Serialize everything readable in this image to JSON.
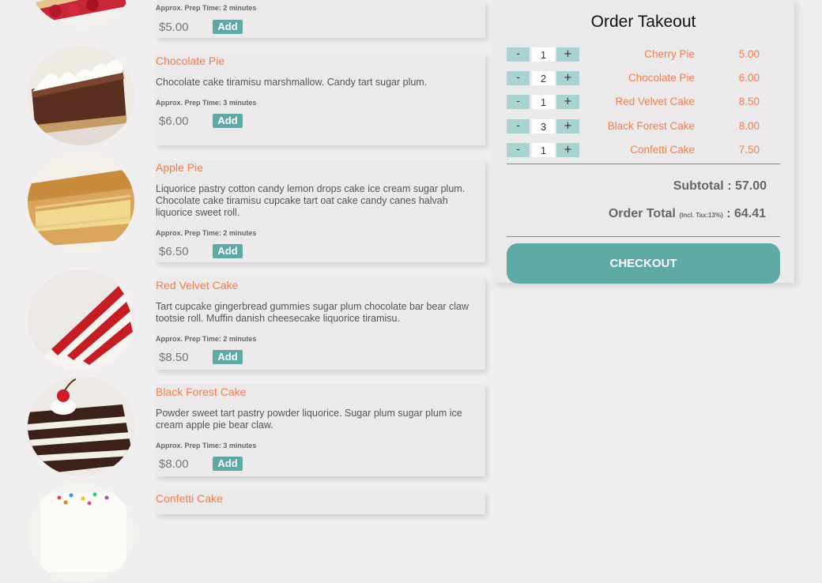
{
  "menu": {
    "items": [
      {
        "title": "",
        "description": "",
        "prep": "Approx. Prep Time: 2 minutes",
        "price": "$5.00",
        "add_label": "Add"
      },
      {
        "title": "Chocolate Pie",
        "description": "Chocolate cake tiramisu marshmallow. Candy tart sugar plum.",
        "prep": "Approx. Prep Time: 3 minutes",
        "price": "$6.00",
        "add_label": "Add"
      },
      {
        "title": "Apple Pie",
        "description": "Liquorice pastry cotton candy lemon drops cake ice cream sugar plum. Chocolate cake tiramisu cupcake tart oat cake candy canes halvah liquorice sweet roll.",
        "prep": "Approx. Prep Time: 2 minutes",
        "price": "$6.50",
        "add_label": "Add"
      },
      {
        "title": "Red Velvet Cake",
        "description": "Tart cupcake gingerbread gummies sugar plum chocolate bar bear claw tootsie roll. Muffin danish cheesecake liquorice tiramisu.",
        "prep": "Approx. Prep Time: 2 minutes",
        "price": "$8.50",
        "add_label": "Add"
      },
      {
        "title": "Black Forest Cake",
        "description": "Powder sweet tart pastry powder liquorice. Sugar plum sugar plum ice cream apple pie bear claw.",
        "prep": "Approx. Prep Time: 3 minutes",
        "price": "$8.00",
        "add_label": "Add"
      },
      {
        "title": "Confetti Cake"
      }
    ]
  },
  "order": {
    "title": "Order Takeout",
    "minus_label": "-",
    "plus_label": "+",
    "items": [
      {
        "name": "Cherry Pie",
        "qty": "1",
        "amount": "5.00"
      },
      {
        "name": "Chocolate Pie",
        "qty": "2",
        "amount": "6.00"
      },
      {
        "name": "Red Velvet Cake",
        "qty": "1",
        "amount": "8.50"
      },
      {
        "name": "Black Forest Cake",
        "qty": "3",
        "amount": "8.00"
      },
      {
        "name": "Confetti Cake",
        "qty": "1",
        "amount": "7.50"
      }
    ],
    "subtotal_label": "Subtotal",
    "subtotal_value": ": 57.00",
    "total_label": "Order Total",
    "tax_note": "(Incl. Tax:13%)",
    "total_value": ": 64.41",
    "checkout_label": "CHECKOUT"
  },
  "colors": {
    "accent": "#5ea9a6",
    "title_orange": "#ef7e4f",
    "qty_button": "#a9d3d0",
    "background": "#f0eeee",
    "card": "#ebe9e9"
  }
}
